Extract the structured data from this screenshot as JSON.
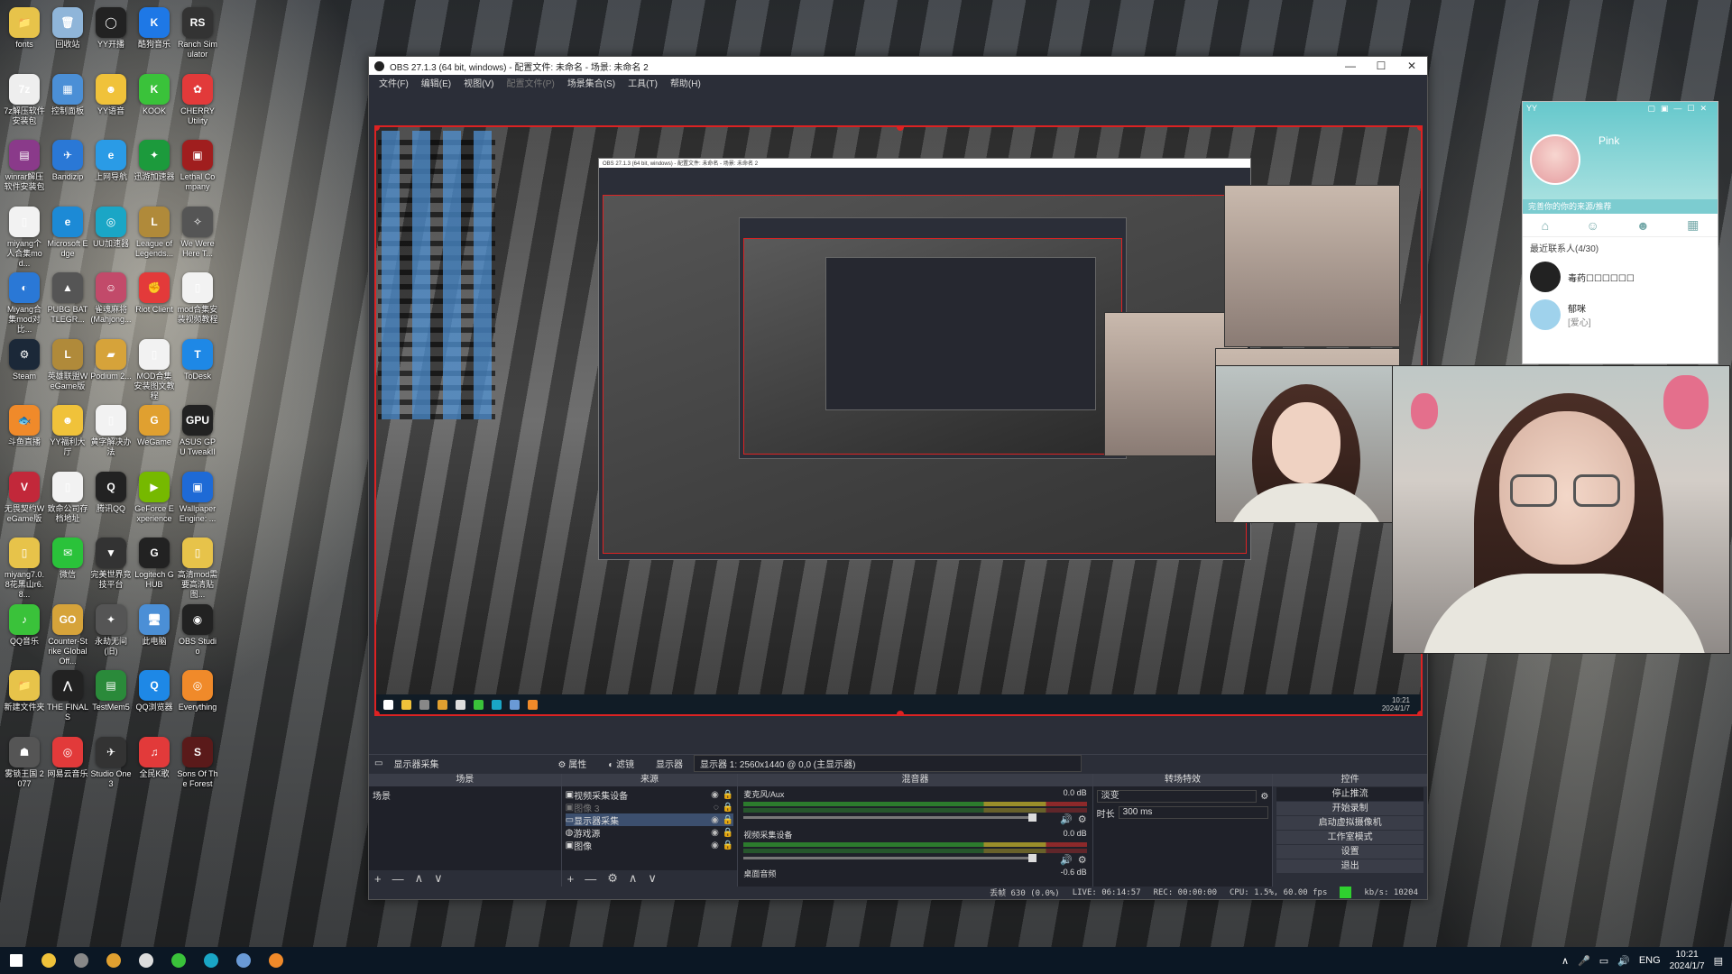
{
  "desktop": {
    "icons": [
      {
        "label": "fonts",
        "color": "#e7c34a",
        "glyph": "📁"
      },
      {
        "label": "回收站",
        "color": "#8fb5d9",
        "glyph": "🗑"
      },
      {
        "label": "YY开播",
        "color": "#222",
        "glyph": "◯"
      },
      {
        "label": "酷狗音乐",
        "color": "#1e78e6",
        "glyph": "K"
      },
      {
        "label": "Ranch Simulator",
        "color": "#333",
        "glyph": "RS"
      },
      {
        "label": "7z解压软件安装包",
        "color": "#eee",
        "glyph": "7z"
      },
      {
        "label": "控制面板",
        "color": "#4b8fd6",
        "glyph": "▦"
      },
      {
        "label": "YY语音",
        "color": "#f0c23a",
        "glyph": "☻"
      },
      {
        "label": "KOOK",
        "color": "#3ac23a",
        "glyph": "K"
      },
      {
        "label": "CHERRY Utility",
        "color": "#e23a3a",
        "glyph": "✿"
      },
      {
        "label": "winrar解压软件安装包",
        "color": "#8a3a8a",
        "glyph": "▤"
      },
      {
        "label": "Bandizip",
        "color": "#2a78d6",
        "glyph": "✈"
      },
      {
        "label": "上网导航",
        "color": "#2a9be6",
        "glyph": "e"
      },
      {
        "label": "迅游加速器",
        "color": "#1c9a3c",
        "glyph": "✦"
      },
      {
        "label": "Lethal Company",
        "color": "#a01e1e",
        "glyph": "▣"
      },
      {
        "label": "miyang个人合集mod...",
        "color": "#f2f2f2",
        "glyph": "▯"
      },
      {
        "label": "Microsoft Edge",
        "color": "#1c8ad6",
        "glyph": "e"
      },
      {
        "label": "UU加速器",
        "color": "#1aa6c6",
        "glyph": "◎"
      },
      {
        "label": "League of Legends...",
        "color": "#b08a3a",
        "glyph": "L"
      },
      {
        "label": "We Were Here T...",
        "color": "#555",
        "glyph": "✧"
      },
      {
        "label": "Miyang合集mod对比...",
        "color": "#2a78d6",
        "glyph": "◐"
      },
      {
        "label": "PUBG BATTLEGR...",
        "color": "#555",
        "glyph": "▲"
      },
      {
        "label": "雀魂麻将(Mahjong...",
        "color": "#c24a6a",
        "glyph": "☺"
      },
      {
        "label": "Riot Client",
        "color": "#e33a3a",
        "glyph": "✊"
      },
      {
        "label": "mod合集安装视频教程",
        "color": "#f2f2f2",
        "glyph": "▯"
      },
      {
        "label": "Steam",
        "color": "#1b2838",
        "glyph": "⚙"
      },
      {
        "label": "英雄联盟WeGame版",
        "color": "#b08a3a",
        "glyph": "L"
      },
      {
        "label": "Podium 2...",
        "color": "#d6a33a",
        "glyph": "▰"
      },
      {
        "label": "MOD合集安装图文教程",
        "color": "#f2f2f2",
        "glyph": "▯"
      },
      {
        "label": "ToDesk",
        "color": "#1e88e6",
        "glyph": "T"
      },
      {
        "label": "斗鱼直播",
        "color": "#f08a2a",
        "glyph": "🐟"
      },
      {
        "label": "YY福利大厅",
        "color": "#f0c23a",
        "glyph": "☻"
      },
      {
        "label": "黄字解决办法",
        "color": "#f2f2f2",
        "glyph": "▯"
      },
      {
        "label": "WeGame",
        "color": "#e0a030",
        "glyph": "G"
      },
      {
        "label": "ASUS GPU TweakII",
        "color": "#222",
        "glyph": "GPU"
      },
      {
        "label": "无畏契约WeGame版",
        "color": "#c2283a",
        "glyph": "V"
      },
      {
        "label": "致命公司存档地址",
        "color": "#f2f2f2",
        "glyph": "▯"
      },
      {
        "label": "腾讯QQ",
        "color": "#222",
        "glyph": "Q"
      },
      {
        "label": "GeForce Experience",
        "color": "#76b900",
        "glyph": "▶"
      },
      {
        "label": "Wallpaper Engine: ...",
        "color": "#1e6ad6",
        "glyph": "▣"
      },
      {
        "label": "miyang7.0.8花黑山r6.8...",
        "color": "#e7c34a",
        "glyph": "▯"
      },
      {
        "label": "微信",
        "color": "#2ac23a",
        "glyph": "✉"
      },
      {
        "label": "完美世界竞技平台",
        "color": "#333",
        "glyph": "▼"
      },
      {
        "label": "Logitech G HUB",
        "color": "#222",
        "glyph": "G"
      },
      {
        "label": "高清mod需要高清贴图...",
        "color": "#e7c34a",
        "glyph": "▯"
      },
      {
        "label": "QQ音乐",
        "color": "#3ac23a",
        "glyph": "♪"
      },
      {
        "label": "Counter-Strike Global Off...",
        "color": "#d6a33a",
        "glyph": "GO"
      },
      {
        "label": "永劫无间(旧)",
        "color": "#555",
        "glyph": "✦"
      },
      {
        "label": "此电脑",
        "color": "#4b8fd6",
        "glyph": "🖥"
      },
      {
        "label": "OBS Studio",
        "color": "#222",
        "glyph": "◉"
      },
      {
        "label": "新建文件夹",
        "color": "#e7c34a",
        "glyph": "📁"
      },
      {
        "label": "THE FINALS",
        "color": "#222",
        "glyph": "⋀"
      },
      {
        "label": "TestMem5",
        "color": "#2a8a3a",
        "glyph": "▤"
      },
      {
        "label": "QQ浏览器",
        "color": "#1e88e6",
        "glyph": "Q"
      },
      {
        "label": "Everything",
        "color": "#f08a2a",
        "glyph": "◎"
      },
      {
        "label": "雾锁王国 2077",
        "color": "#555",
        "glyph": "☗"
      },
      {
        "label": "网易云音乐",
        "color": "#e23a3a",
        "glyph": "◎"
      },
      {
        "label": "Studio One 3",
        "color": "#333",
        "glyph": "✈"
      },
      {
        "label": "全民K歌",
        "color": "#e23a3a",
        "glyph": "♫"
      },
      {
        "label": "Sons Of The Forest",
        "color": "#5a1a1a",
        "glyph": "S"
      }
    ]
  },
  "obs": {
    "title": "OBS 27.1.3 (64 bit, windows) - 配置文件: 未命名 - 场景: 未命名 2",
    "window_controls": [
      "—",
      "☐",
      "✕"
    ],
    "menu": [
      "文件(F)",
      "编辑(E)",
      "视图(V)",
      "配置文件(P)",
      "场景集合(S)",
      "工具(T)",
      "帮助(H)"
    ],
    "source_bar": {
      "name": "显示器采集",
      "properties": "属性",
      "filters": "滤镜",
      "display_label": "显示器",
      "display_value": "显示器 1: 2560x1440 @ 0,0 (主显示器)"
    },
    "scenes": {
      "header": "场景",
      "items": [
        "场景"
      ]
    },
    "sources": {
      "header": "来源",
      "items": [
        "视频采集设备",
        "图像 3",
        "显示器采集",
        "游戏源",
        "图像"
      ]
    },
    "mixer": {
      "header": "混音器",
      "channels": [
        {
          "name": "麦克风/Aux",
          "db": "0.0 dB"
        },
        {
          "name": "视频采集设备",
          "db": "0.0 dB"
        }
      ],
      "next": "桌面音频",
      "next_db": "-0.6 dB"
    },
    "transitions": {
      "header": "转场特效",
      "type": "淡变",
      "duration_label": "时长",
      "duration": "300 ms"
    },
    "controls": {
      "header": "控件",
      "buttons": [
        "停止推流",
        "开始录制",
        "启动虚拟摄像机",
        "工作室模式",
        "设置",
        "退出"
      ]
    },
    "status": {
      "dropped": "丢帧 630 (0.0%)",
      "live": "LIVE: 06:14:57",
      "rec": "REC: 00:00:00",
      "cpu": "CPU: 1.5%, 60.00 fps",
      "kbps": "kb/s: 10204"
    },
    "dock_footer_icons": {
      "add": "+",
      "remove": "—",
      "up": "∧",
      "down": "∨",
      "gear": "⚙"
    },
    "nested_title": "OBS 27.1.3 (64 bit, windows) - 配置文件: 未命名 - 场景: 未命名 2",
    "preview_clock": "10:21\n2024/1/7"
  },
  "chat": {
    "title": "YY",
    "name": "Pink",
    "search": "完善你的你的来源/推荐",
    "group": "最近联系人(4/30)",
    "contacts": [
      {
        "name": "毒药☐☐☐☐☐☐",
        "sub": ""
      },
      {
        "name": "郁咪",
        "sub": "[爱心]"
      }
    ],
    "colors": {
      "header": "#66c8cc"
    }
  },
  "taskbar": {
    "clock_time": "10:21",
    "clock_date": "2024/1/7",
    "lang": "ENG",
    "apps": [
      {
        "name": "start",
        "color": "#fff"
      },
      {
        "name": "yy",
        "color": "#f0c23a"
      },
      {
        "name": "obs",
        "color": "#888"
      },
      {
        "name": "yy-voice",
        "color": "#e0a030"
      },
      {
        "name": "studio-one",
        "color": "#ddd"
      },
      {
        "name": "qq-music",
        "color": "#3ac23a"
      },
      {
        "name": "uu",
        "color": "#1aa6c6"
      },
      {
        "name": "steam",
        "color": "#6a9ad6"
      },
      {
        "name": "douyu",
        "color": "#f08a2a"
      }
    ]
  }
}
